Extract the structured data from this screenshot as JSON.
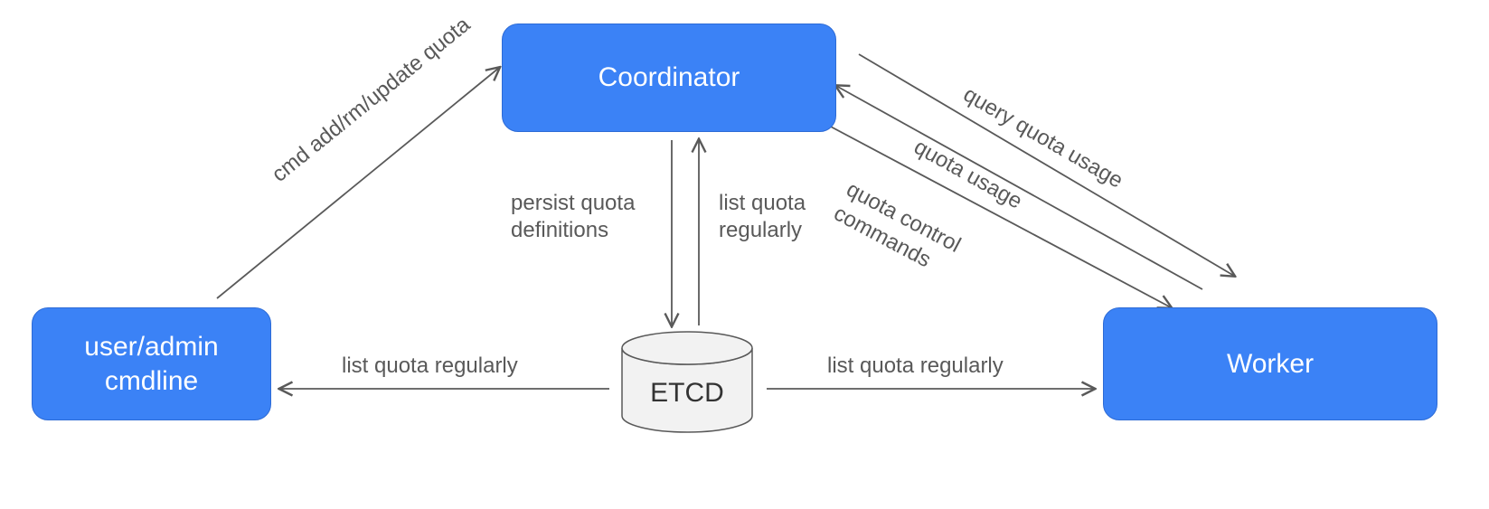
{
  "nodes": {
    "coordinator": "Coordinator",
    "cmdline": "user/admin\ncmdline",
    "worker": "Worker",
    "etcd": "ETCD"
  },
  "edges": {
    "cmd_to_coord": "cmd add/rm/update quota",
    "coord_etcd_down": "persist quota\ndefinitions",
    "coord_etcd_up": "list quota\nregularly",
    "etcd_to_cmdline": "list quota regularly",
    "etcd_to_worker": "list quota regularly",
    "coord_worker_query": "query quota usage",
    "coord_worker_usage": "quota usage",
    "coord_worker_ctrl": "quota control\ncommands"
  }
}
